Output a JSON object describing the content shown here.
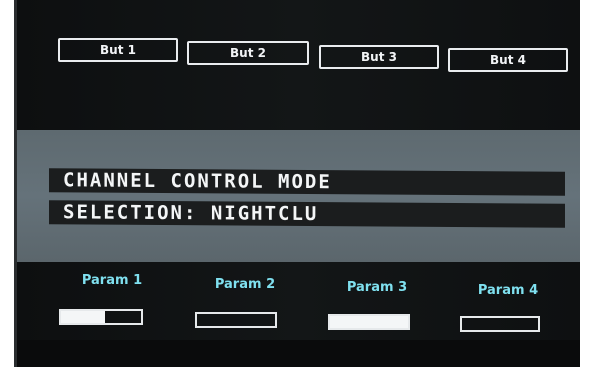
{
  "buttons": [
    {
      "label": "But 1"
    },
    {
      "label": "But 2"
    },
    {
      "label": "But 3"
    },
    {
      "label": "But 4"
    }
  ],
  "display": {
    "line1": "CHANNEL CONTROL MODE",
    "line2": "SELECTION: NIGHTCLU"
  },
  "params": [
    {
      "label": "Param 1",
      "level": 0.55
    },
    {
      "label": "Param 2",
      "level": 0.0
    },
    {
      "label": "Param 3",
      "level": 1.0
    },
    {
      "label": "Param 4",
      "level": 0.0
    }
  ],
  "colors": {
    "param_label": "#7fe0ef",
    "panel": "#5e6a70",
    "lcd_text": "#f4f6f7"
  }
}
